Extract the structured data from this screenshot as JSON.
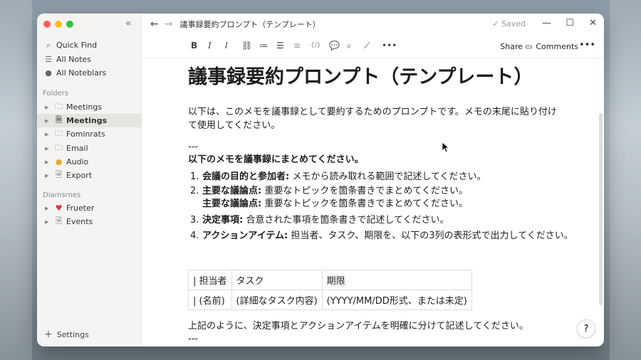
{
  "window": {
    "title": "議事録要約プロンプト（テンプレート）",
    "saved_label": "Saved",
    "colors": {
      "close": "#ff5f57",
      "minimize": "#febc2e",
      "maximize": "#28c840"
    }
  },
  "sidebar": {
    "nav": [
      {
        "icon": "search-icon",
        "label": "Quick Find"
      },
      {
        "icon": "list-icon",
        "label": "All Notes"
      },
      {
        "icon": "notebook-icon",
        "label": "All Noteblars"
      }
    ],
    "folders_label": "Folders",
    "folders": [
      {
        "icon": "folder-icon",
        "label": "Meetings",
        "active": false
      },
      {
        "icon": "document-icon",
        "label": "Meetings",
        "active": true
      },
      {
        "icon": "folder-icon",
        "label": "Fominrats",
        "active": false
      },
      {
        "icon": "folder-icon",
        "label": "Email",
        "active": false
      },
      {
        "icon": "bulb-icon",
        "label": "Audio",
        "active": false
      },
      {
        "icon": "document-icon",
        "label": "Export",
        "active": false
      }
    ],
    "second_label": "Diamsrnes",
    "second_items": [
      {
        "icon": "heart-icon",
        "label": "Frueter"
      },
      {
        "icon": "document-icon",
        "label": "Events"
      }
    ],
    "settings_label": "Settings"
  },
  "toolbar": {
    "share_label": "Share",
    "comments_label": "Comments"
  },
  "doc": {
    "heading": "議事録要約プロンプト（テンプレート）",
    "intro": "以下は、このメモを議事録として要約するためのプロンプトです。メモの末尾に貼り付けて使用してください。",
    "sep_top": "---",
    "instruction": "以下のメモを議事録にまとめてください。",
    "list": [
      {
        "num": "1.",
        "bold": "会議の目的と参加者:",
        "text": " メモから読み取れる範囲で記述してください。"
      },
      {
        "num": "2.",
        "bold": "主要な議論点:",
        "text": " 重要なトピックを箇条書きでまとめてください。"
      },
      {
        "num": "",
        "bold": "主要な議論点:",
        "text": " 重要なトピックを箇条書きでまとめてください。"
      },
      {
        "num": "3.",
        "bold": "決定事項:",
        "text": " 合意された事項を箇条書きで記述してください。"
      },
      {
        "num": "4.",
        "bold": "アクションアイテム:",
        "text": " 担当者、タスク、期限を、以下の3列の表形式で出力してください。"
      }
    ],
    "table": {
      "header": [
        "| 担当者",
        "タスク",
        "期限"
      ],
      "row": [
        "| (名前)",
        "(詳細なタスク内容)",
        "(YYYY/MM/DD形式、または未定)"
      ]
    },
    "closing": "上記のように、決定事項とアクションアイテムを明確に分けて記述してください。",
    "sep_bottom": "---"
  },
  "help_label": "?"
}
